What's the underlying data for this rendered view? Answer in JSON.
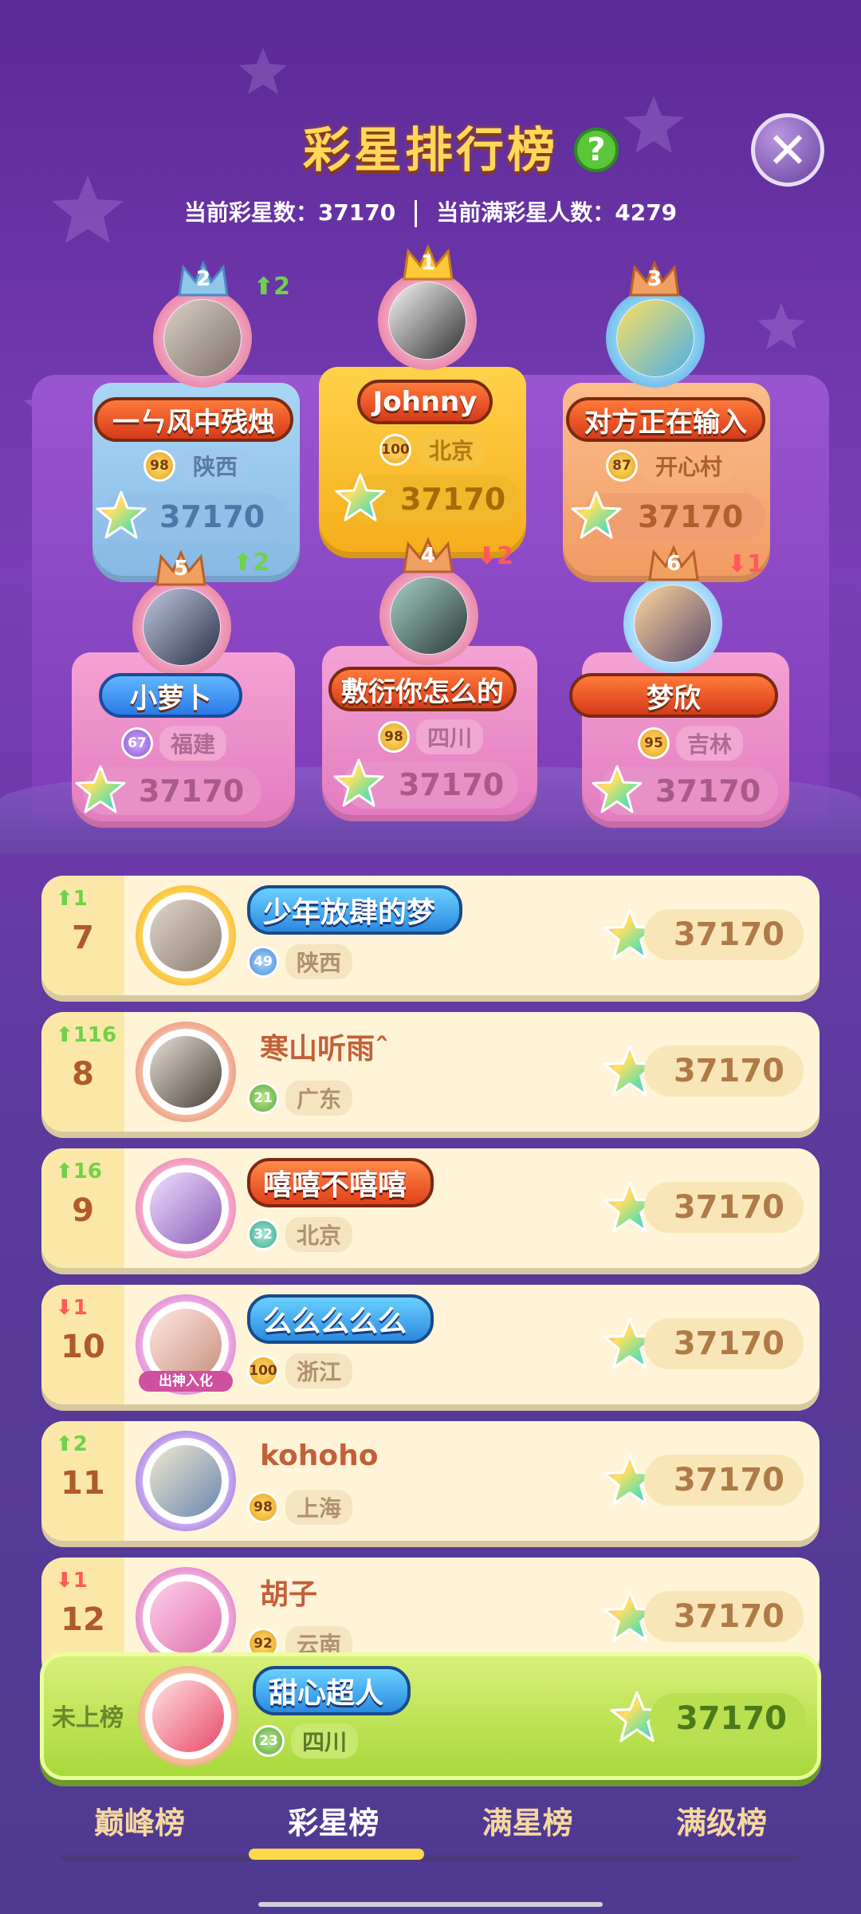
{
  "header": {
    "title": "彩星排行榜",
    "help_label": "?",
    "close_label": "✕",
    "current_stars_label": "当前彩星数：37170",
    "full_star_count_label": "当前满彩星人数：4279"
  },
  "podium": [
    {
      "rank": "1",
      "name": "Johnny",
      "level": "100",
      "location": "北京",
      "score": "37170",
      "change": ""
    },
    {
      "rank": "2",
      "name": "一ㄣ风中残烛",
      "level": "98",
      "location": "陕西",
      "score": "37170",
      "change": "2"
    },
    {
      "rank": "3",
      "name": "对方正在输入",
      "level": "87",
      "location": "开心村",
      "score": "37170",
      "change": ""
    },
    {
      "rank": "4",
      "name": "敷衍你怎么的",
      "level": "98",
      "location": "四川",
      "score": "37170",
      "change": "2"
    },
    {
      "rank": "5",
      "name": "小萝卜",
      "level": "67",
      "location": "福建",
      "score": "37170",
      "change": "2"
    },
    {
      "rank": "6",
      "name": "梦欣",
      "level": "95",
      "location": "吉林",
      "score": "37170",
      "change": "1"
    }
  ],
  "list": [
    {
      "rank": "7",
      "change": "1",
      "dir": "up",
      "name": "少年放肆的梦",
      "level": "49",
      "location": "陕西",
      "score": "37170"
    },
    {
      "rank": "8",
      "change": "116",
      "dir": "up",
      "name": "寒山听雨ˆ",
      "level": "21",
      "location": "广东",
      "score": "37170"
    },
    {
      "rank": "9",
      "change": "16",
      "dir": "up",
      "name": "嘻嘻不嘻嘻",
      "level": "32",
      "location": "北京",
      "score": "37170"
    },
    {
      "rank": "10",
      "change": "1",
      "dir": "down",
      "name": "么么么么么",
      "level": "100",
      "location": "浙江",
      "score": "37170",
      "badge": "出神入化"
    },
    {
      "rank": "11",
      "change": "2",
      "dir": "up",
      "name": "kohoho",
      "level": "98",
      "location": "上海",
      "score": "37170"
    },
    {
      "rank": "12",
      "change": "1",
      "dir": "down",
      "name": "胡子",
      "level": "92",
      "location": "云南",
      "score": "37170"
    }
  ],
  "self": {
    "rank_text": "未上榜",
    "name": "甜心超人",
    "level": "23",
    "location": "四川",
    "score": "37170"
  },
  "tabs": [
    "巅峰榜",
    "彩星榜",
    "满星榜",
    "满级榜"
  ],
  "active_tab": "彩星榜",
  "colors": {
    "accent": "#ffd84a",
    "up": "#6fd24a",
    "down": "#ff5a5a",
    "row_bg": "#fff4d8",
    "self_bg": "#a8d83a"
  }
}
